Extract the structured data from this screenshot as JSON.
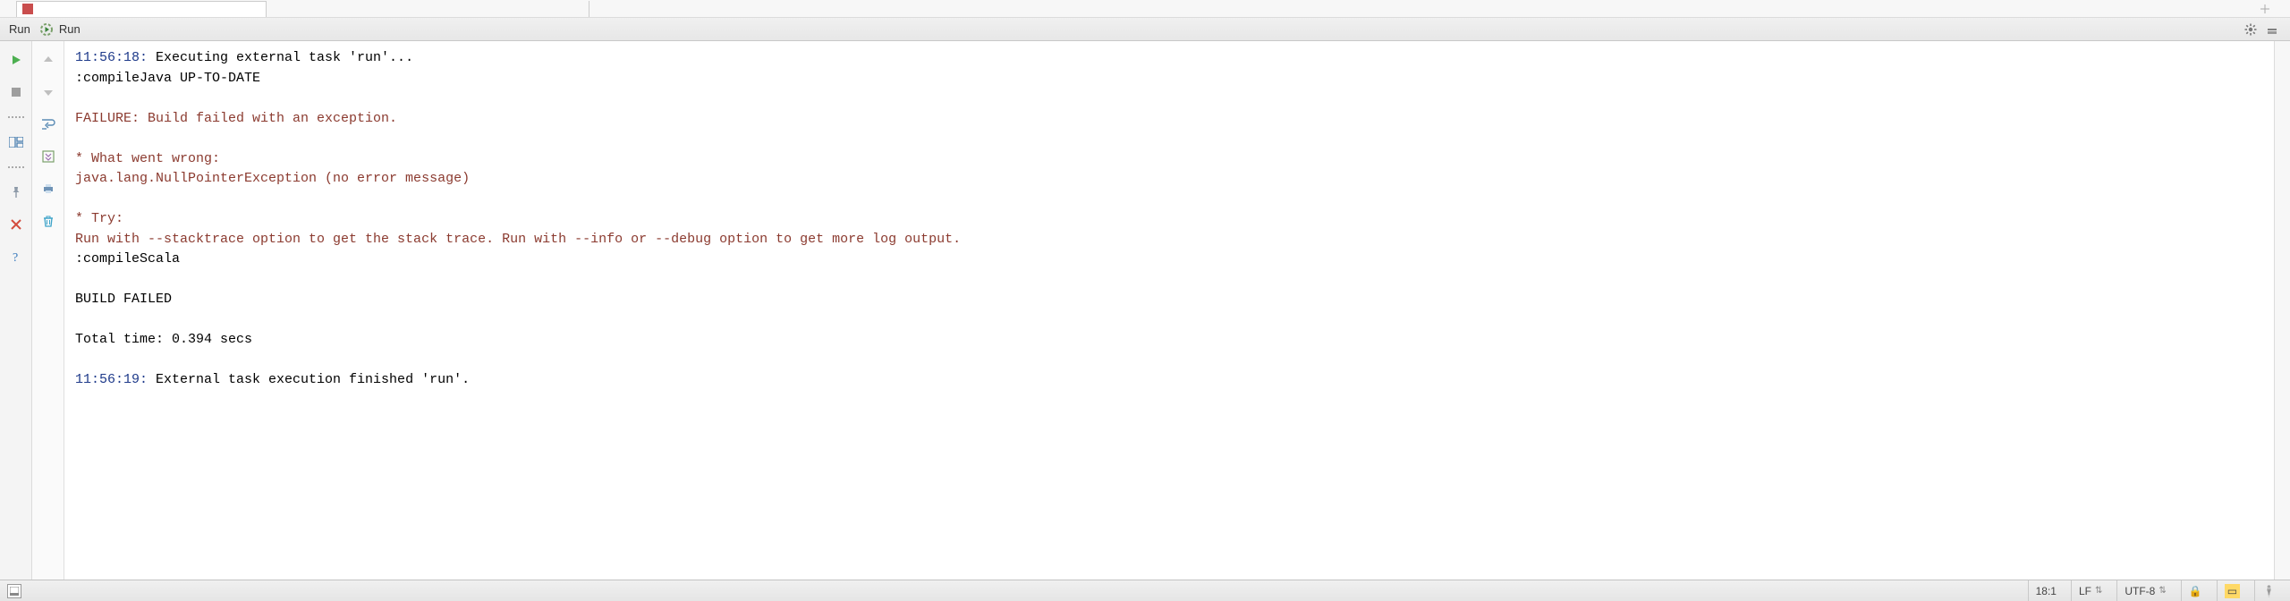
{
  "toolwindow": {
    "title": "Run",
    "config_name": "Run"
  },
  "tab_stub": "",
  "console": {
    "l01_time": "11:56:18:",
    "l01_rest": " Executing external task 'run'...",
    "l02": ":compileJava UP-TO-DATE",
    "l03": "",
    "l04": "FAILURE: Build failed with an exception.",
    "l05": "",
    "l06": "* What went wrong:",
    "l07": "java.lang.NullPointerException (no error message)",
    "l08": "",
    "l09": "* Try:",
    "l10": "Run with --stacktrace option to get the stack trace. Run with --info or --debug option to get more log output.",
    "l11": ":compileScala",
    "l12": "",
    "l13": "BUILD FAILED",
    "l14": "",
    "l15": "Total time: 0.394 secs",
    "l16": "",
    "l17_time": "11:56:19:",
    "l17_rest": " External task execution finished 'run'."
  },
  "status": {
    "caret": "18:1",
    "line_sep": "LF",
    "encoding": "UTF-8"
  }
}
